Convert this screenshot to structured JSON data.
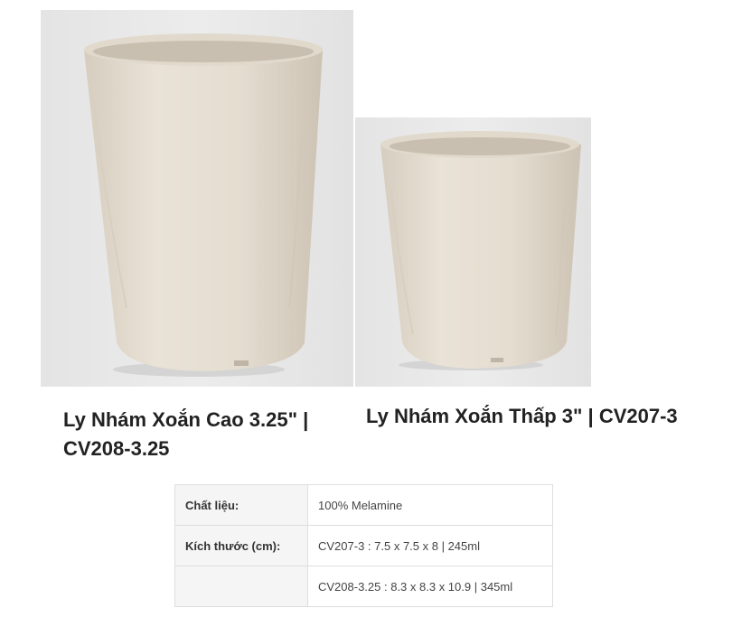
{
  "products": [
    {
      "title": "Ly Nhám Xoắn Cao 3.25\" | CV208-3.25",
      "image_icon": "tall-beige-speckled-melamine-cup"
    },
    {
      "title": "Ly Nhám Xoắn Thấp 3\" | CV207-3",
      "image_icon": "short-beige-speckled-melamine-cup"
    }
  ],
  "specs": {
    "material_label": "Chất liệu:",
    "material_value": "100% Melamine",
    "size_label": "Kích thước (cm):",
    "size_value_1": "CV207-3 : 7.5 x 7.5 x 8 | 245ml",
    "size_value_2": "CV208-3.25 : 8.3 x 8.3 x 10.9 | 345ml"
  },
  "colors": {
    "background": "#ffffff",
    "photo_background": "#e8e8e8",
    "cup_color": "#e6dfd3",
    "table_label_bg": "#f5f5f5",
    "table_border": "#dedede"
  }
}
